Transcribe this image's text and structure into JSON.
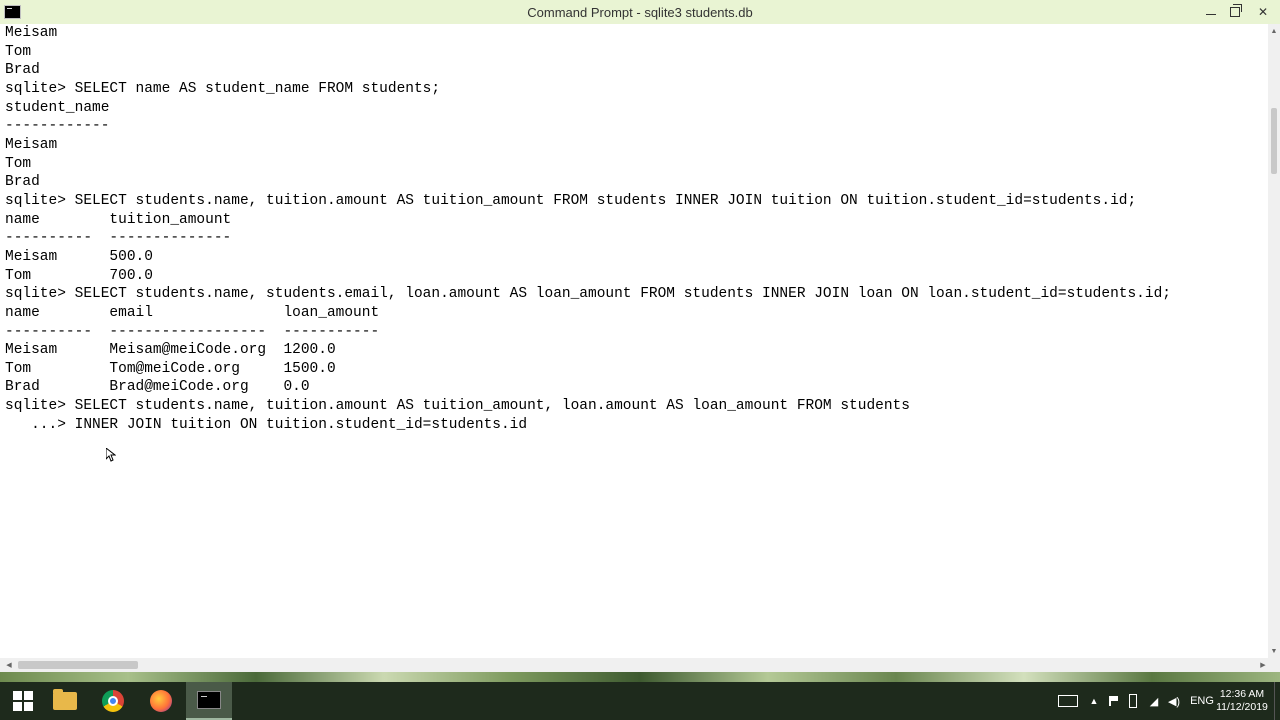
{
  "window": {
    "title": "Command Prompt - sqlite3  students.db"
  },
  "console": {
    "lines": [
      "Meisam",
      "Tom",
      "Brad",
      "sqlite> SELECT name AS student_name FROM students;",
      "student_name",
      "------------",
      "Meisam",
      "Tom",
      "Brad",
      "sqlite> SELECT students.name, tuition.amount AS tuition_amount FROM students INNER JOIN tuition ON tuition.student_id=students.id;",
      "name        tuition_amount",
      "----------  --------------",
      "Meisam      500.0",
      "Tom         700.0",
      "sqlite> SELECT students.name, students.email, loan.amount AS loan_amount FROM students INNER JOIN loan ON loan.student_id=students.id;",
      "name        email               loan_amount",
      "----------  ------------------  -----------",
      "Meisam      Meisam@meiCode.org  1200.0",
      "Tom         Tom@meiCode.org     1500.0",
      "Brad        Brad@meiCode.org    0.0",
      "sqlite> SELECT students.name, tuition.amount AS tuition_amount, loan.amount AS loan_amount FROM students",
      "   ...> INNER JOIN tuition ON tuition.student_id=students.id"
    ]
  },
  "taskbar": {
    "language": "ENG",
    "time": "12:36 AM",
    "date": "11/12/2019"
  }
}
